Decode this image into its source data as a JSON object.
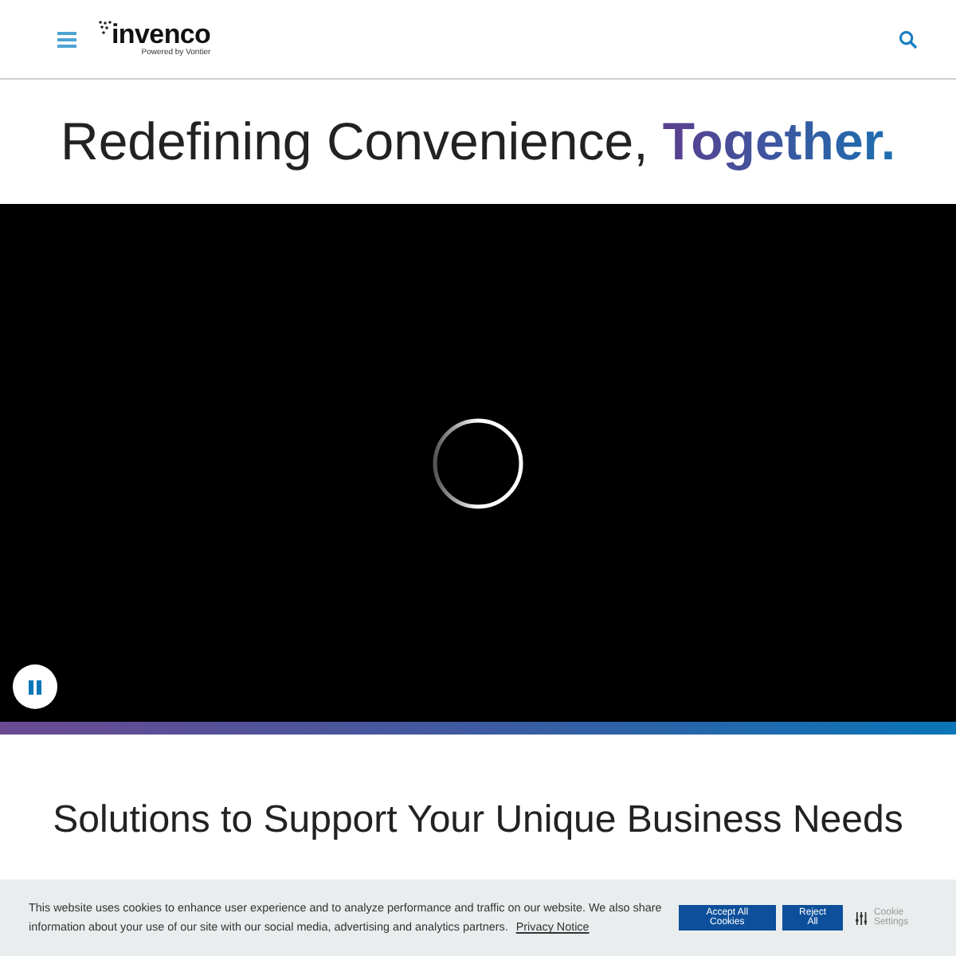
{
  "header": {
    "logo": "invenco",
    "tagline": "Powered by Vontier"
  },
  "hero": {
    "headline": "Redefining Convenience,",
    "highlight": "Together."
  },
  "video": {
    "playing": true
  },
  "section": {
    "heading": "Solutions to Support Your Unique Business Needs"
  },
  "cookie_banner": {
    "text": "This website uses cookies to enhance user experience and to analyze performance and traffic on our website. We also share information about your use of our site with our social media, advertising and analytics partners.",
    "link": "Privacy Notice",
    "buttons": [
      "Accept All Cookies",
      "Reject All"
    ],
    "settings": "Cookie Settings"
  }
}
